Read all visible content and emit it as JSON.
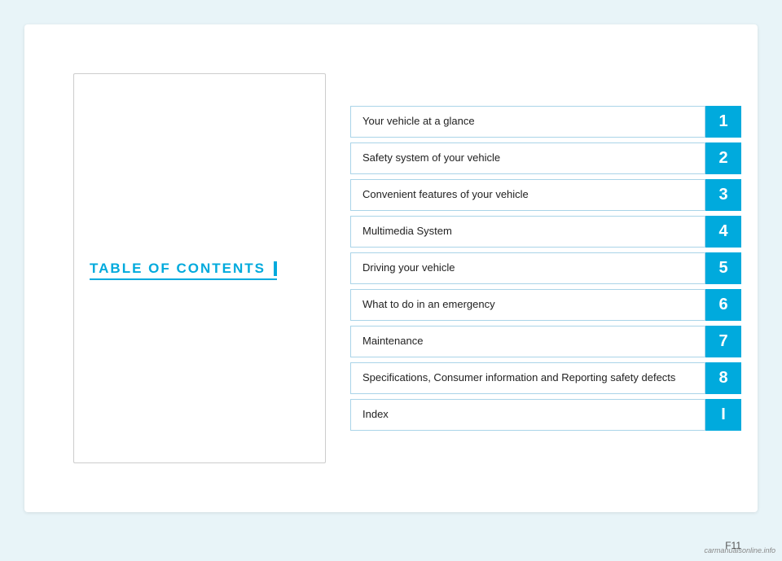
{
  "page": {
    "background_color": "#e8f4f8",
    "footer_page": "F11",
    "watermark": "carmanualsonline.info"
  },
  "left": {
    "toc_title": "TABLE OF CONTENTS"
  },
  "toc_items": [
    {
      "label": "Your vehicle at a glance",
      "number": "1"
    },
    {
      "label": "Safety system of your vehicle",
      "number": "2"
    },
    {
      "label": "Convenient features of your vehicle",
      "number": "3"
    },
    {
      "label": "Multimedia System",
      "number": "4"
    },
    {
      "label": "Driving your vehicle",
      "number": "5"
    },
    {
      "label": "What to do in an emergency",
      "number": "6"
    },
    {
      "label": "Maintenance",
      "number": "7"
    },
    {
      "label": "Specifications, Consumer information and Reporting safety defects",
      "number": "8"
    },
    {
      "label": "Index",
      "number": "I"
    }
  ]
}
